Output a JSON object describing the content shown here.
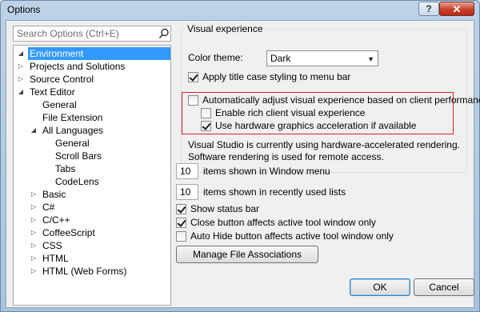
{
  "window": {
    "title": "Options",
    "help_button": "?",
    "close_button": "✕"
  },
  "search": {
    "placeholder": "Search Options (Ctrl+E)"
  },
  "tree": [
    {
      "label": "Environment",
      "selected": true
    },
    {
      "label": "Projects and Solutions"
    },
    {
      "label": "Source Control"
    },
    {
      "label": "Text Editor"
    },
    {
      "label": "General"
    },
    {
      "label": "File Extension"
    },
    {
      "label": "All Languages"
    },
    {
      "label": "General"
    },
    {
      "label": "Scroll Bars"
    },
    {
      "label": "Tabs"
    },
    {
      "label": "CodeLens"
    },
    {
      "label": "Basic"
    },
    {
      "label": "C#"
    },
    {
      "label": "C/C++"
    },
    {
      "label": "CoffeeScript"
    },
    {
      "label": "CSS"
    },
    {
      "label": "HTML"
    },
    {
      "label": "HTML (Web Forms)"
    }
  ],
  "visual": {
    "group_label": "Visual experience",
    "color_theme_label": "Color theme:",
    "color_theme_value": "Dark",
    "apply_title_case": "Apply title case styling to menu bar",
    "auto_adjust": "Automatically adjust visual experience based on client performance",
    "rich_client": "Enable rich client visual experience",
    "hw_accel": "Use hardware graphics acceleration if available",
    "note": "Visual Studio is currently using hardware-accelerated rendering. Software rendering is used for remote access."
  },
  "window_menu": {
    "value": "10",
    "label": "items shown in Window menu"
  },
  "recent_lists": {
    "value": "10",
    "label": "items shown in recently used lists"
  },
  "status_bar": "Show status bar",
  "close_btn_affects": "Close button affects active tool window only",
  "autohide_affects": "Auto Hide button affects active tool window only",
  "manage_file_assoc": "Manage File Associations",
  "buttons": {
    "ok": "OK",
    "cancel": "Cancel"
  }
}
